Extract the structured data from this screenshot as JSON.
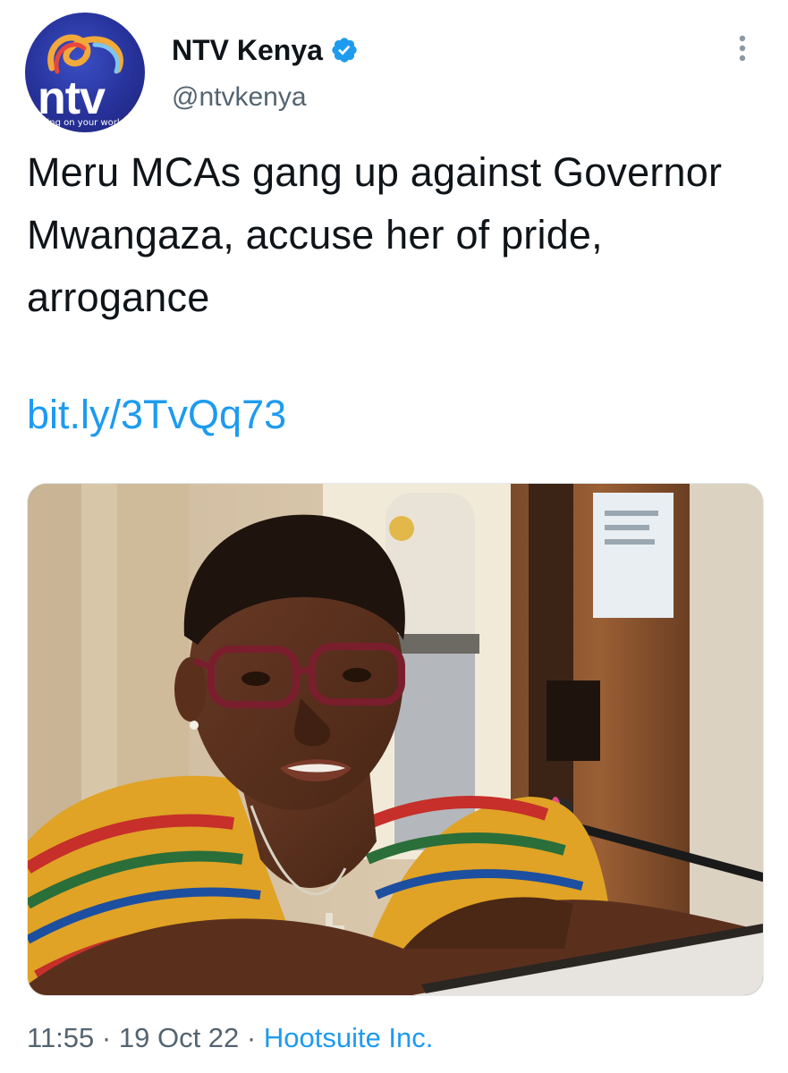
{
  "author": {
    "display_name": "NTV Kenya",
    "handle": "@ntvkenya",
    "verified": true,
    "avatar": {
      "logo_text": "ntv",
      "tagline": "turning on your world",
      "icon": "ntv-logo-icon"
    }
  },
  "tweet": {
    "text": "Meru MCAs gang up against Governor Mwangaza, accuse her of pride, arrogance",
    "link": "bit.ly/3TvQq73",
    "media": {
      "icon": "photo-governor-at-microphone"
    }
  },
  "meta": {
    "time": "11:55",
    "separator": "·",
    "date": "19 Oct 22",
    "source": "Hootsuite Inc."
  },
  "icons": {
    "verified": "verified-badge-icon",
    "more": "more-options-icon"
  },
  "colors": {
    "link": "#1d9bf0",
    "secondary_text": "#536471",
    "primary_text": "#0f1419",
    "avatar_bg": "#27329a"
  }
}
